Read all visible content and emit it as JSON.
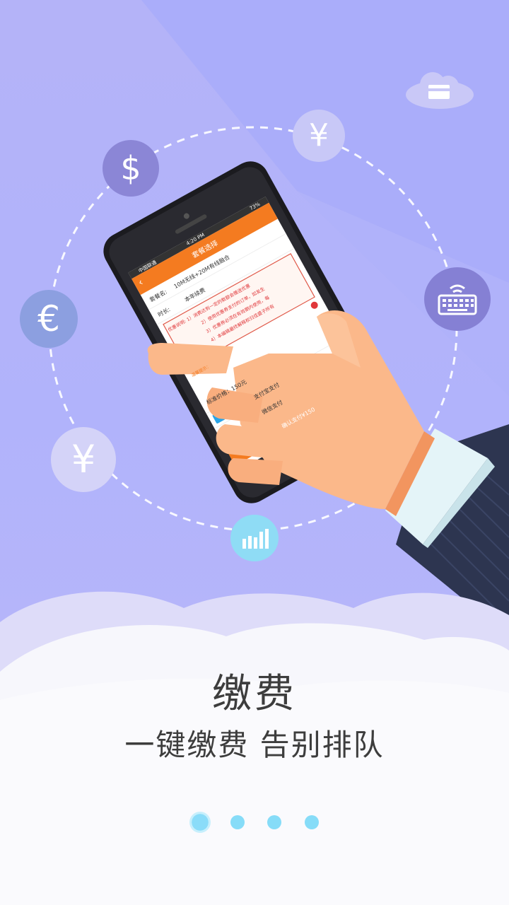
{
  "onboarding": {
    "title": "缴费",
    "subtitle": "一键缴费 告别排队",
    "page_count": 4,
    "current_page": 1
  },
  "currency_icons": {
    "dollar": "$",
    "yen_top": "¥",
    "euro": "€",
    "yen_left": "¥"
  },
  "phone_screen": {
    "status_carrier": "中国联通",
    "status_time": "4:20 PM",
    "status_battery": "73%",
    "header_title": "套餐选择",
    "package_label": "套餐名:",
    "package_value": "10M无线+20M有线融合",
    "duration_label": "时长:",
    "duration_value": "本年续费",
    "notice_line1": "优惠说明: 1）消费达到一定的数额会赠送优惠",
    "notice_line2": "2）使用优惠券支付的订单，如发生",
    "notice_line3": "3）优惠券必须在有效期内使用，每",
    "notice_line4": "4）本编辑最终解释权归佳盛子所有",
    "warm_tip": "温馨提示：",
    "price_label": "标准价格：150元",
    "alipay_label": "支付宝支付",
    "wechat_label": "微信支付",
    "confirm_button": "确认支付¥150"
  },
  "colors": {
    "accent_orange": "#f47b20",
    "dot_blue": "#86dcf8",
    "coin_purple": "#8b86d6",
    "background_purple": "#b4b3f8"
  }
}
